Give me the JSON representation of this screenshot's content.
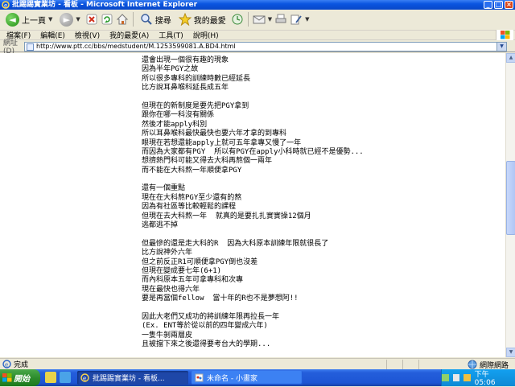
{
  "window": {
    "title": "批踢踢實業坊 - 看板 - Microsoft Internet Explorer"
  },
  "toolbar": {
    "back_label": "上一頁",
    "search_label": "搜尋",
    "favorites_label": "我的最愛"
  },
  "menu": [
    "檔案(F)",
    "編輯(E)",
    "檢視(V)",
    "我的最愛(A)",
    "工具(T)",
    "說明(H)"
  ],
  "address": {
    "label": "網址(D)",
    "url": "http://www.ptt.cc/bbs/medstudent/M.1253599081.A.BD4.html"
  },
  "article_lines": [
    "還會出現一個很有趣的現象",
    "因為半年PGY之故",
    "所以很多專科的訓練時數已經延長",
    "比方說耳鼻喉科延長成五年",
    "",
    "但現在的新制度是要先把PGY拿到",
    "跟你在哪一科沒有關係",
    "然後才能apply科別",
    "所以耳鼻喉科最快最快也要六年才拿的到專科",
    "眼現在若想還能apply上就可五年拿專又慢了一年",
    "而因為大家都有PGY  所以有PGY在apply小科時就已經不是優勢...",
    "想擠熱門科可能又得去大科再熬個一兩年",
    "而不能在大科熬一年順便拿PGY",
    "",
    "還有一個重點",
    "現在在大科熬PGY至少還有的熬",
    "因為有社區等比較輕鬆的課程",
    "但現在去大科熬一年  就真的是要扎扎實實操12個月",
    "逃都逃不掉",
    "",
    "但最慘的還是走大科的R  因為大科原本訓練年限就很長了",
    "比方說神外六年",
    "但之前反正R1可順便拿PGY倒也沒差",
    "但現在變成要七年(6+1)",
    "而內科原本五年可拿專科和次專",
    "現在最快也得六年",
    "要是再當個fellow  當十年的R也不是夢想阿!!",
    "",
    "因此大老們又成功的將訓練年限再拉長一年",
    "(Ex. ENT等於從以前的四年變成六年)",
    "一隻牛剝兩層皮",
    "且被擋下來之後還得要考台大的學期..."
  ],
  "status": {
    "left": "完成",
    "zone": "網際網路"
  },
  "taskbar": {
    "start_label": "開始",
    "tasks": [
      "批踢踢實業坊 - 看板...",
      "未命名 - 小畫家"
    ],
    "clock": "下午 05:06"
  },
  "colors": {
    "title_bar": "#0a55e0",
    "taskbar": "#245edb",
    "start_button": "#2d8c2d",
    "tray": "#0f89d4"
  }
}
